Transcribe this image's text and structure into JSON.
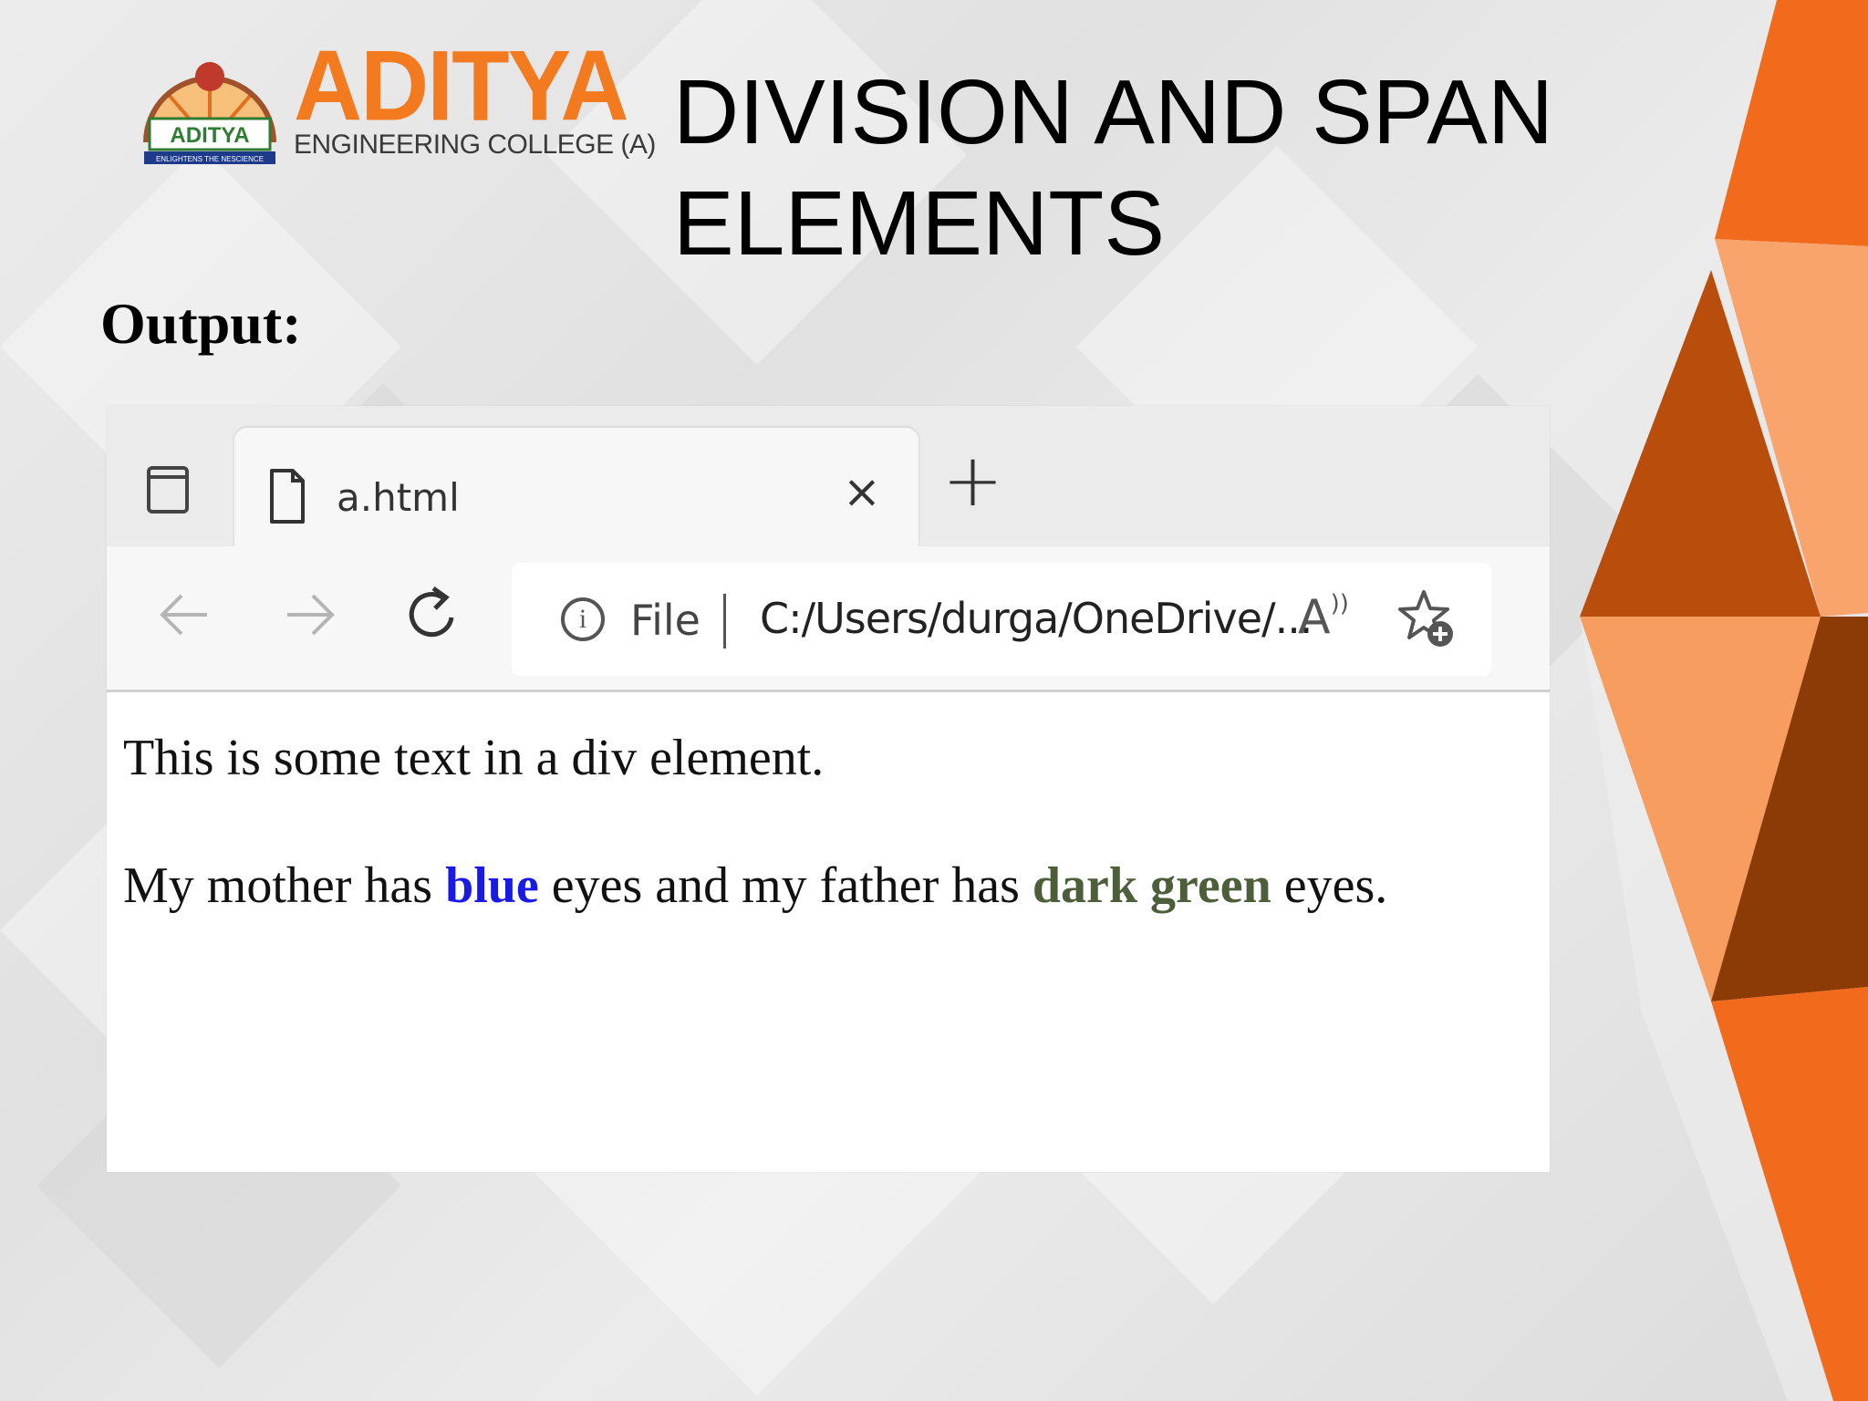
{
  "slide": {
    "title": "DIVISION AND SPAN ELEMENTS",
    "output_label": "Output:"
  },
  "logo": {
    "name": "ADITYA",
    "subtitle": "ENGINEERING COLLEGE (A)",
    "emblem_text": "ADITYA",
    "emblem_banner": "ENLIGHTENS THE NESCIENCE"
  },
  "browser": {
    "tab": {
      "label": "a.html",
      "close_glyph": "×",
      "new_tab_glyph": "+"
    },
    "address_bar": {
      "scheme_label": "File",
      "url": "C:/Users/durga/OneDrive/..."
    },
    "page": {
      "div_text": "This is some text in a div element.",
      "span_sentence": {
        "part1": "My mother has ",
        "blue_word": "blue",
        "part2": " eyes and my father has ",
        "green_word": "dark green",
        "part3": " eyes."
      }
    }
  },
  "colors": {
    "accent_orange": "#f47a20",
    "blue_word": "#1a1ae6",
    "green_word": "#4d5f3a"
  }
}
